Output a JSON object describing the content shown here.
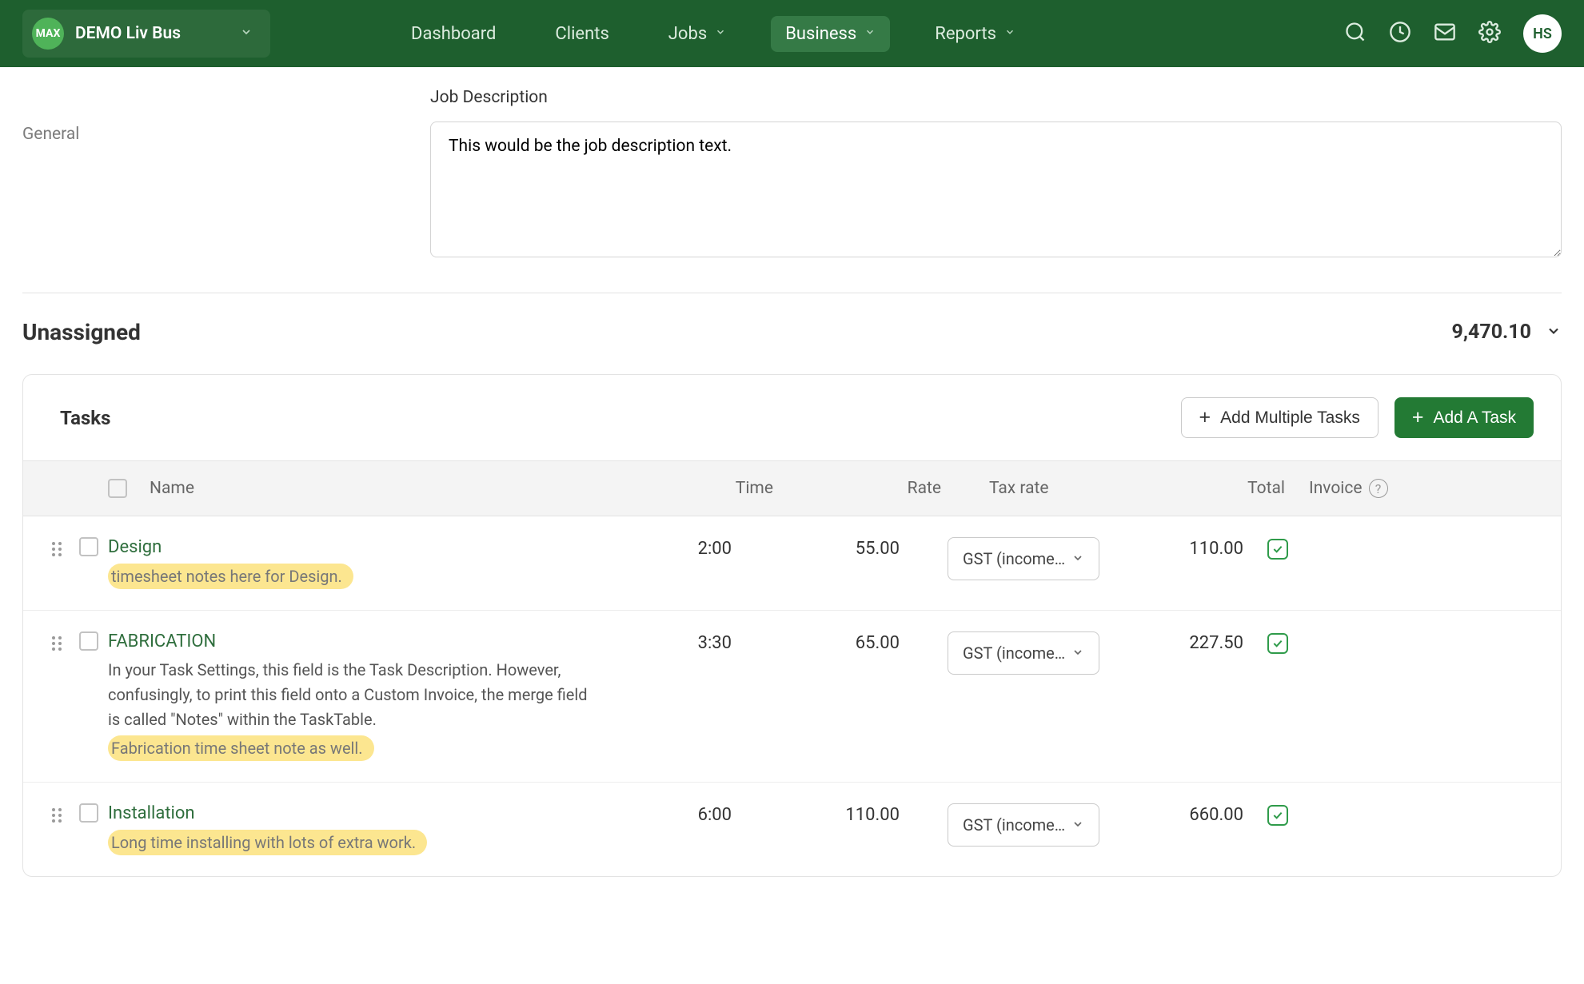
{
  "topbar": {
    "org_badge": "MAX",
    "org_name": "DEMO Liv Bus",
    "nav": {
      "dashboard": "Dashboard",
      "clients": "Clients",
      "jobs": "Jobs",
      "business": "Business",
      "reports": "Reports"
    },
    "user_initials": "HS"
  },
  "description": {
    "side_label": "General",
    "label": "Job Description",
    "value": "This would be the job description text."
  },
  "section": {
    "title": "Unassigned",
    "total": "9,470.10"
  },
  "tasks": {
    "title": "Tasks",
    "add_multiple_label": "Add Multiple Tasks",
    "add_task_label": "Add A Task",
    "columns": {
      "name": "Name",
      "time": "Time",
      "rate": "Rate",
      "tax": "Tax rate",
      "total": "Total",
      "invoice": "Invoice"
    },
    "rows": [
      {
        "name": "Design",
        "description": "",
        "note": "timesheet notes here for Design.",
        "time": "2:00",
        "rate": "55.00",
        "tax": "GST (income…",
        "total": "110.00"
      },
      {
        "name": "FABRICATION",
        "description": "In your Task Settings, this field is the Task Description. However, confusingly, to print this field onto a Custom Invoice, the merge field is called \"Notes\" within the TaskTable.",
        "note": "Fabrication time sheet note as well.",
        "time": "3:30",
        "rate": "65.00",
        "tax": "GST (income…",
        "total": "227.50"
      },
      {
        "name": "Installation",
        "description": "",
        "note": "Long time installing with lots of extra work.",
        "time": "6:00",
        "rate": "110.00",
        "tax": "GST (income…",
        "total": "660.00"
      }
    ]
  }
}
